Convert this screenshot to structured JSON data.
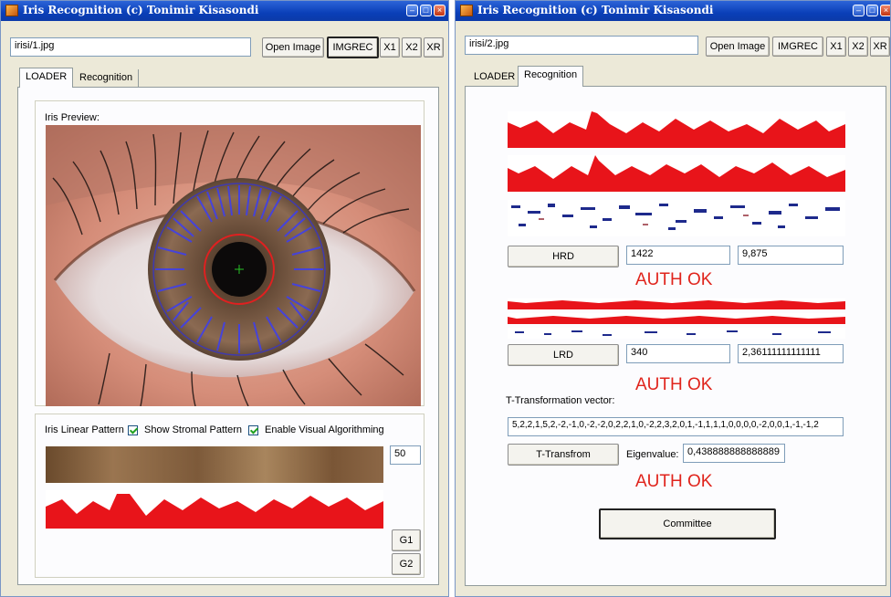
{
  "window_left": {
    "title": "Iris Recognition (c) Tonimir Kisasondi",
    "path_value": "irisi/1.jpg",
    "buttons": {
      "open_image": "Open Image",
      "imgrec": "IMGREC",
      "x1": "X1",
      "x2": "X2",
      "xr": "XR"
    },
    "tabs": [
      "LOADER",
      "Recognition"
    ],
    "iris_preview_label": "Iris Preview:",
    "linear_pattern_label": "Iris Linear Pattern",
    "show_stromal_label": "Show Stromal Pattern",
    "enable_visual_label": "Enable Visual Algorithming",
    "threshold_value": "50",
    "g1": "G1",
    "g2": "G2"
  },
  "window_right": {
    "title": "Iris Recognition (c) Tonimir Kisasondi",
    "path_value": "irisi/2.jpg",
    "buttons": {
      "open_image": "Open Image",
      "imgrec": "IMGREC",
      "x1": "X1",
      "x2": "X2",
      "xr": "XR"
    },
    "tabs": [
      "LOADER",
      "Recognition"
    ],
    "hrd": {
      "button": "HRD",
      "value1": "1422",
      "value2": "9,875",
      "result": "AUTH OK"
    },
    "lrd": {
      "button": "LRD",
      "value1": "340",
      "value2": "2,36111111111111",
      "result": "AUTH OK"
    },
    "t_vector_label": "T-Transformation vector:",
    "t_vector_value": "5,2,2,1,5,2,-2,-1,0,-2,-2,0,2,2,1,0,-2,2,3,2,0,1,-1,1,1,1,0,0,0,0,-2,0,0,1,-1,-1,2",
    "t_transform_button": "T-Transfrom",
    "eigenvalue_label": "Eigenvalue:",
    "eigenvalue_value": "0,438888888888889",
    "t_result": "AUTH OK",
    "committee_button": "Committee"
  },
  "colors": {
    "pattern_red": "#e8141a",
    "auth_red": "#e0241c",
    "title_blue": "#0a3fb8",
    "window_bg": "#ece9d8"
  }
}
